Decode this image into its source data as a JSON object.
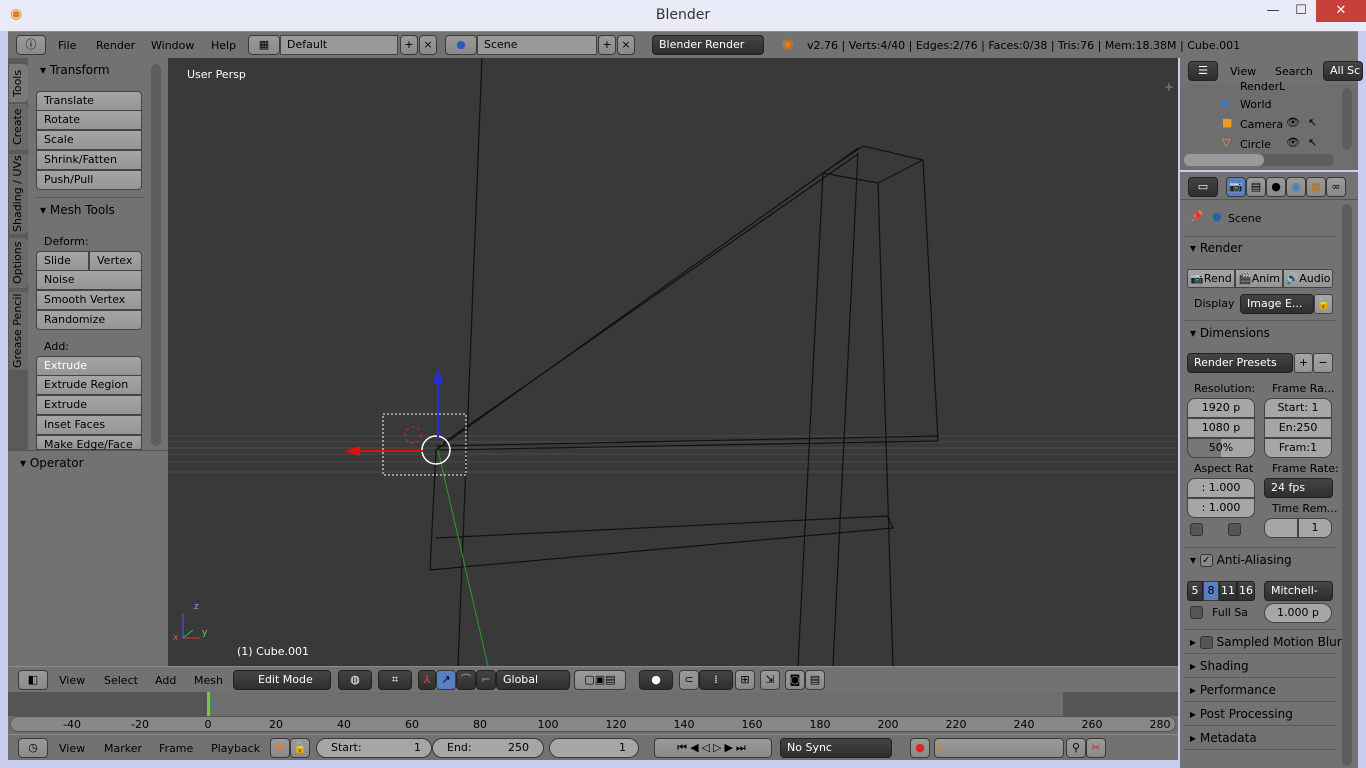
{
  "window": {
    "title": "Blender",
    "minimize": "—",
    "maximize": "☐",
    "close": "✕"
  },
  "top_header": {
    "menus": [
      "File",
      "Render",
      "Window",
      "Help"
    ],
    "layout": "Default",
    "scene": "Scene",
    "engine": "Blender Render",
    "stats": "v2.76 | Verts:4/40 | Edges:2/76 | Faces:0/38 | Tris:76 | Mem:18.38M | Cube.001"
  },
  "toolshelf": {
    "tabs": [
      "Tools",
      "Create",
      "Shading / UVs",
      "Options",
      "Grease Pencil"
    ],
    "transform": {
      "title": "Transform",
      "buttons": [
        "Translate",
        "Rotate",
        "Scale",
        "Shrink/Fatten",
        "Push/Pull"
      ]
    },
    "mesh_tools": {
      "title": "Mesh Tools",
      "deform_label": "Deform:",
      "slide": "Slide Ed",
      "vertex": "Vertex",
      "deform_buttons": [
        "Noise",
        "Smooth Vertex",
        "Randomize"
      ],
      "add_label": "Add:",
      "extrude": "Extrude",
      "add_buttons": [
        "Extrude Region",
        "Extrude Individual",
        "Inset Faces",
        "Make Edge/Face"
      ]
    },
    "operator": "Operator"
  },
  "viewport": {
    "view_label": "User Persp",
    "object_label": "(1) Cube.001",
    "axis": {
      "x": "x",
      "y": "y",
      "z": "z"
    }
  },
  "view3d_header": {
    "menus": [
      "View",
      "Select",
      "Add",
      "Mesh"
    ],
    "mode": "Edit Mode",
    "orientation": "Global"
  },
  "outliner": {
    "menus": [
      "View",
      "Search"
    ],
    "filter": "All Sc",
    "items": [
      "RenderL",
      "World",
      "Camera",
      "Circle"
    ]
  },
  "properties": {
    "context": "Scene",
    "render": {
      "title": "Render",
      "buttons": [
        "Rend",
        "Anim",
        "Audio"
      ],
      "display_label": "Display",
      "display_value": "Image E..."
    },
    "dimensions": {
      "title": "Dimensions",
      "presets": "Render Presets",
      "resolution_label": "Resolution:",
      "res_x": "1920 p",
      "res_y": "1080 p",
      "res_pct": "50%",
      "res_pct_value": 50,
      "frame_range_label": "Frame Ra...",
      "start": "Start: 1",
      "end": "En:250",
      "frame_step": "Fram:1",
      "aspect_label": "Aspect Rat",
      "aspect_x": ": 1.000",
      "aspect_y": ": 1.000",
      "frame_rate_label": "Frame Rate:",
      "frame_rate": "24 fps",
      "time_remap_label": "Time Rem...",
      "time_remap_new": "1"
    },
    "anti_aliasing": {
      "title": "Anti-Aliasing",
      "enabled": true,
      "samples": [
        "5",
        "8",
        "11",
        "16"
      ],
      "selected": "8",
      "filter": "Mitchell-",
      "full_sample": "Full Sa",
      "filter_size": "1.000 p"
    },
    "collapsed": [
      "Sampled Motion Blur",
      "Shading",
      "Performance",
      "Post Processing",
      "Metadata"
    ]
  },
  "timeline": {
    "ticks": [
      "-40",
      "-20",
      "0",
      "20",
      "40",
      "60",
      "80",
      "100",
      "120",
      "140",
      "160",
      "180",
      "200",
      "220",
      "240",
      "260",
      "280"
    ],
    "current_frame": 0
  },
  "timeline_header": {
    "menus": [
      "View",
      "Marker",
      "Frame",
      "Playback"
    ],
    "start_label": "Start:",
    "start": "1",
    "end_label": "End:",
    "end": "250",
    "current": "1",
    "sync": "No Sync"
  },
  "colors": {
    "viewport_bg": "#393939",
    "panel": "#727272",
    "accent_blue": "#5680c2",
    "frame_cursor": "#6ecc3e"
  }
}
